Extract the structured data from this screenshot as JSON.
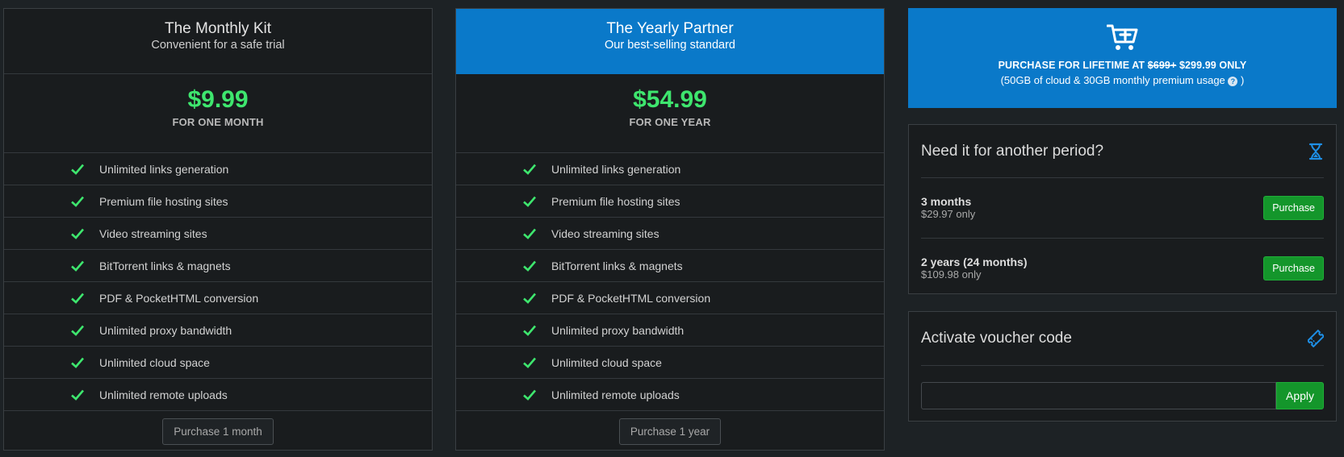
{
  "plans": [
    {
      "title": "The Monthly Kit",
      "subtitle": "Convenient for a safe trial",
      "price": "$9.99",
      "period": "FOR ONE MONTH",
      "features": [
        "Unlimited links generation",
        "Premium file hosting sites",
        "Video streaming sites",
        "BitTorrent links & magnets",
        "PDF & PocketHTML conversion",
        "Unlimited proxy bandwidth",
        "Unlimited cloud space",
        "Unlimited remote uploads"
      ],
      "button_label": "Purchase 1 month"
    },
    {
      "title": "The Yearly Partner",
      "subtitle": "Our best-selling standard",
      "price": "$54.99",
      "period": "FOR ONE YEAR",
      "features": [
        "Unlimited links generation",
        "Premium file hosting sites",
        "Video streaming sites",
        "BitTorrent links & magnets",
        "PDF & PocketHTML conversion",
        "Unlimited proxy bandwidth",
        "Unlimited cloud space",
        "Unlimited remote uploads"
      ],
      "button_label": "Purchase 1 year"
    }
  ],
  "lifetime": {
    "prefix": "PURCHASE FOR LIFETIME AT",
    "old_price": "$699+",
    "new_price": "$299.99 ONLY",
    "note_before": "(50GB of cloud & 30GB monthly premium usage",
    "note_after": ")",
    "help_glyph": "?",
    "icon": "cart-plus-icon"
  },
  "other_period": {
    "title": "Need it for another period?",
    "icon": "hourglass-icon",
    "options": [
      {
        "name": "3 months",
        "price": "$29.97 only",
        "button_label": "Purchase"
      },
      {
        "name": "2 years (24 months)",
        "price": "$109.98 only",
        "button_label": "Purchase"
      }
    ]
  },
  "voucher": {
    "title": "Activate voucher code",
    "icon": "ticket-icon",
    "input_value": "",
    "apply_label": "Apply"
  },
  "colors": {
    "accent_blue": "#0a79c9",
    "price_green": "#3ee66e",
    "button_green": "#14962b",
    "background": "#1d2225",
    "card": "#191c1e"
  }
}
